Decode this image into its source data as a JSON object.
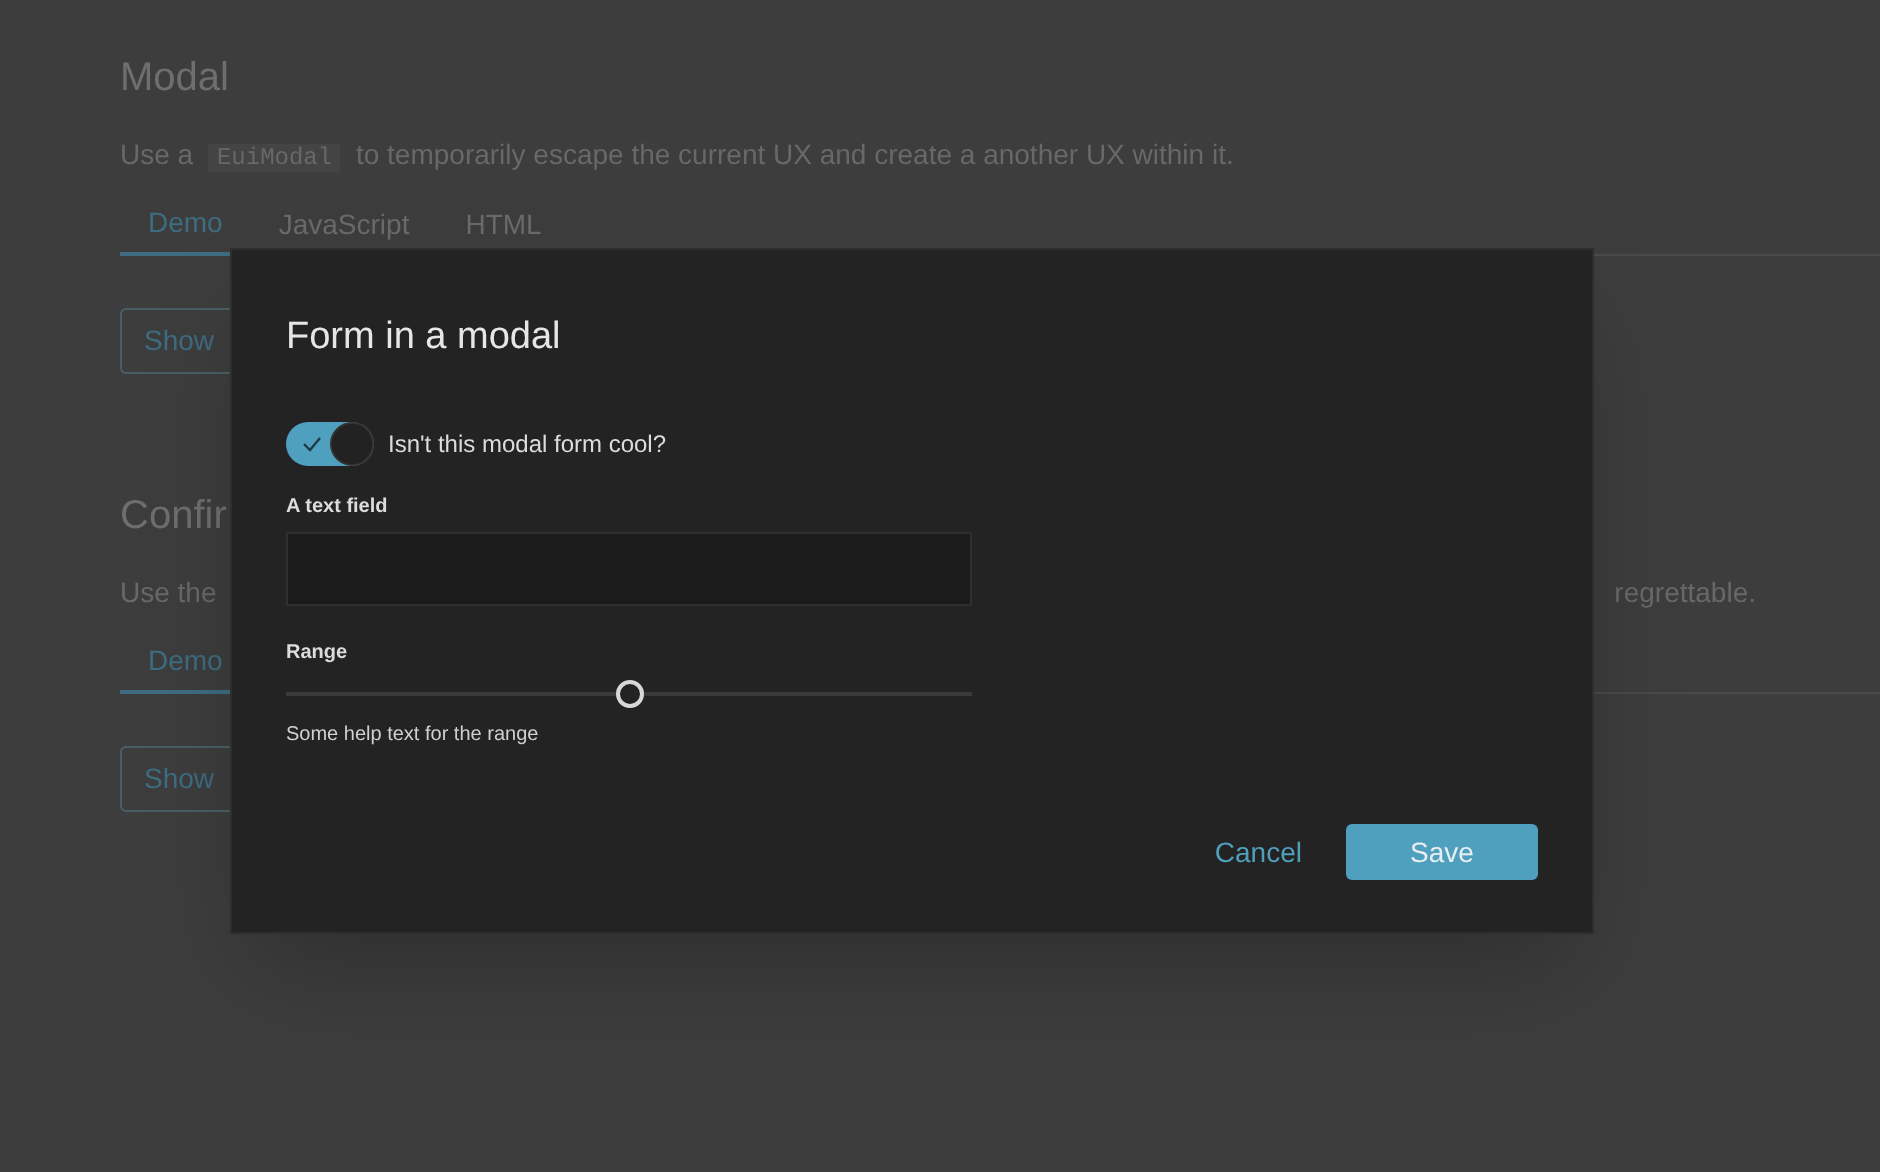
{
  "page": {
    "sections": [
      {
        "title": "Modal",
        "description_parts": [
          "Use a ",
          "EuiModal",
          " to temporarily escape the current UX and create a another UX within it."
        ],
        "tabs": [
          {
            "label": "Demo",
            "selected": true
          },
          {
            "label": "JavaScript",
            "selected": false
          },
          {
            "label": "HTML",
            "selected": false
          }
        ],
        "button": "Show"
      },
      {
        "title": "Confir",
        "description_parts": [
          "Use the "
        ],
        "description_tail": "regrettable.",
        "tabs": [
          {
            "label": "Demo",
            "selected": true
          }
        ],
        "button": "Show"
      }
    ]
  },
  "modal": {
    "title": "Form in a modal",
    "switch": {
      "label": "Isn't this modal form cool?",
      "on": true
    },
    "text_field": {
      "label": "A text field"
    },
    "range": {
      "label": "Range",
      "level": 0.5,
      "help": "Some help text for the range"
    },
    "buttons": {
      "cancel": "Cancel",
      "save": "Save"
    }
  }
}
